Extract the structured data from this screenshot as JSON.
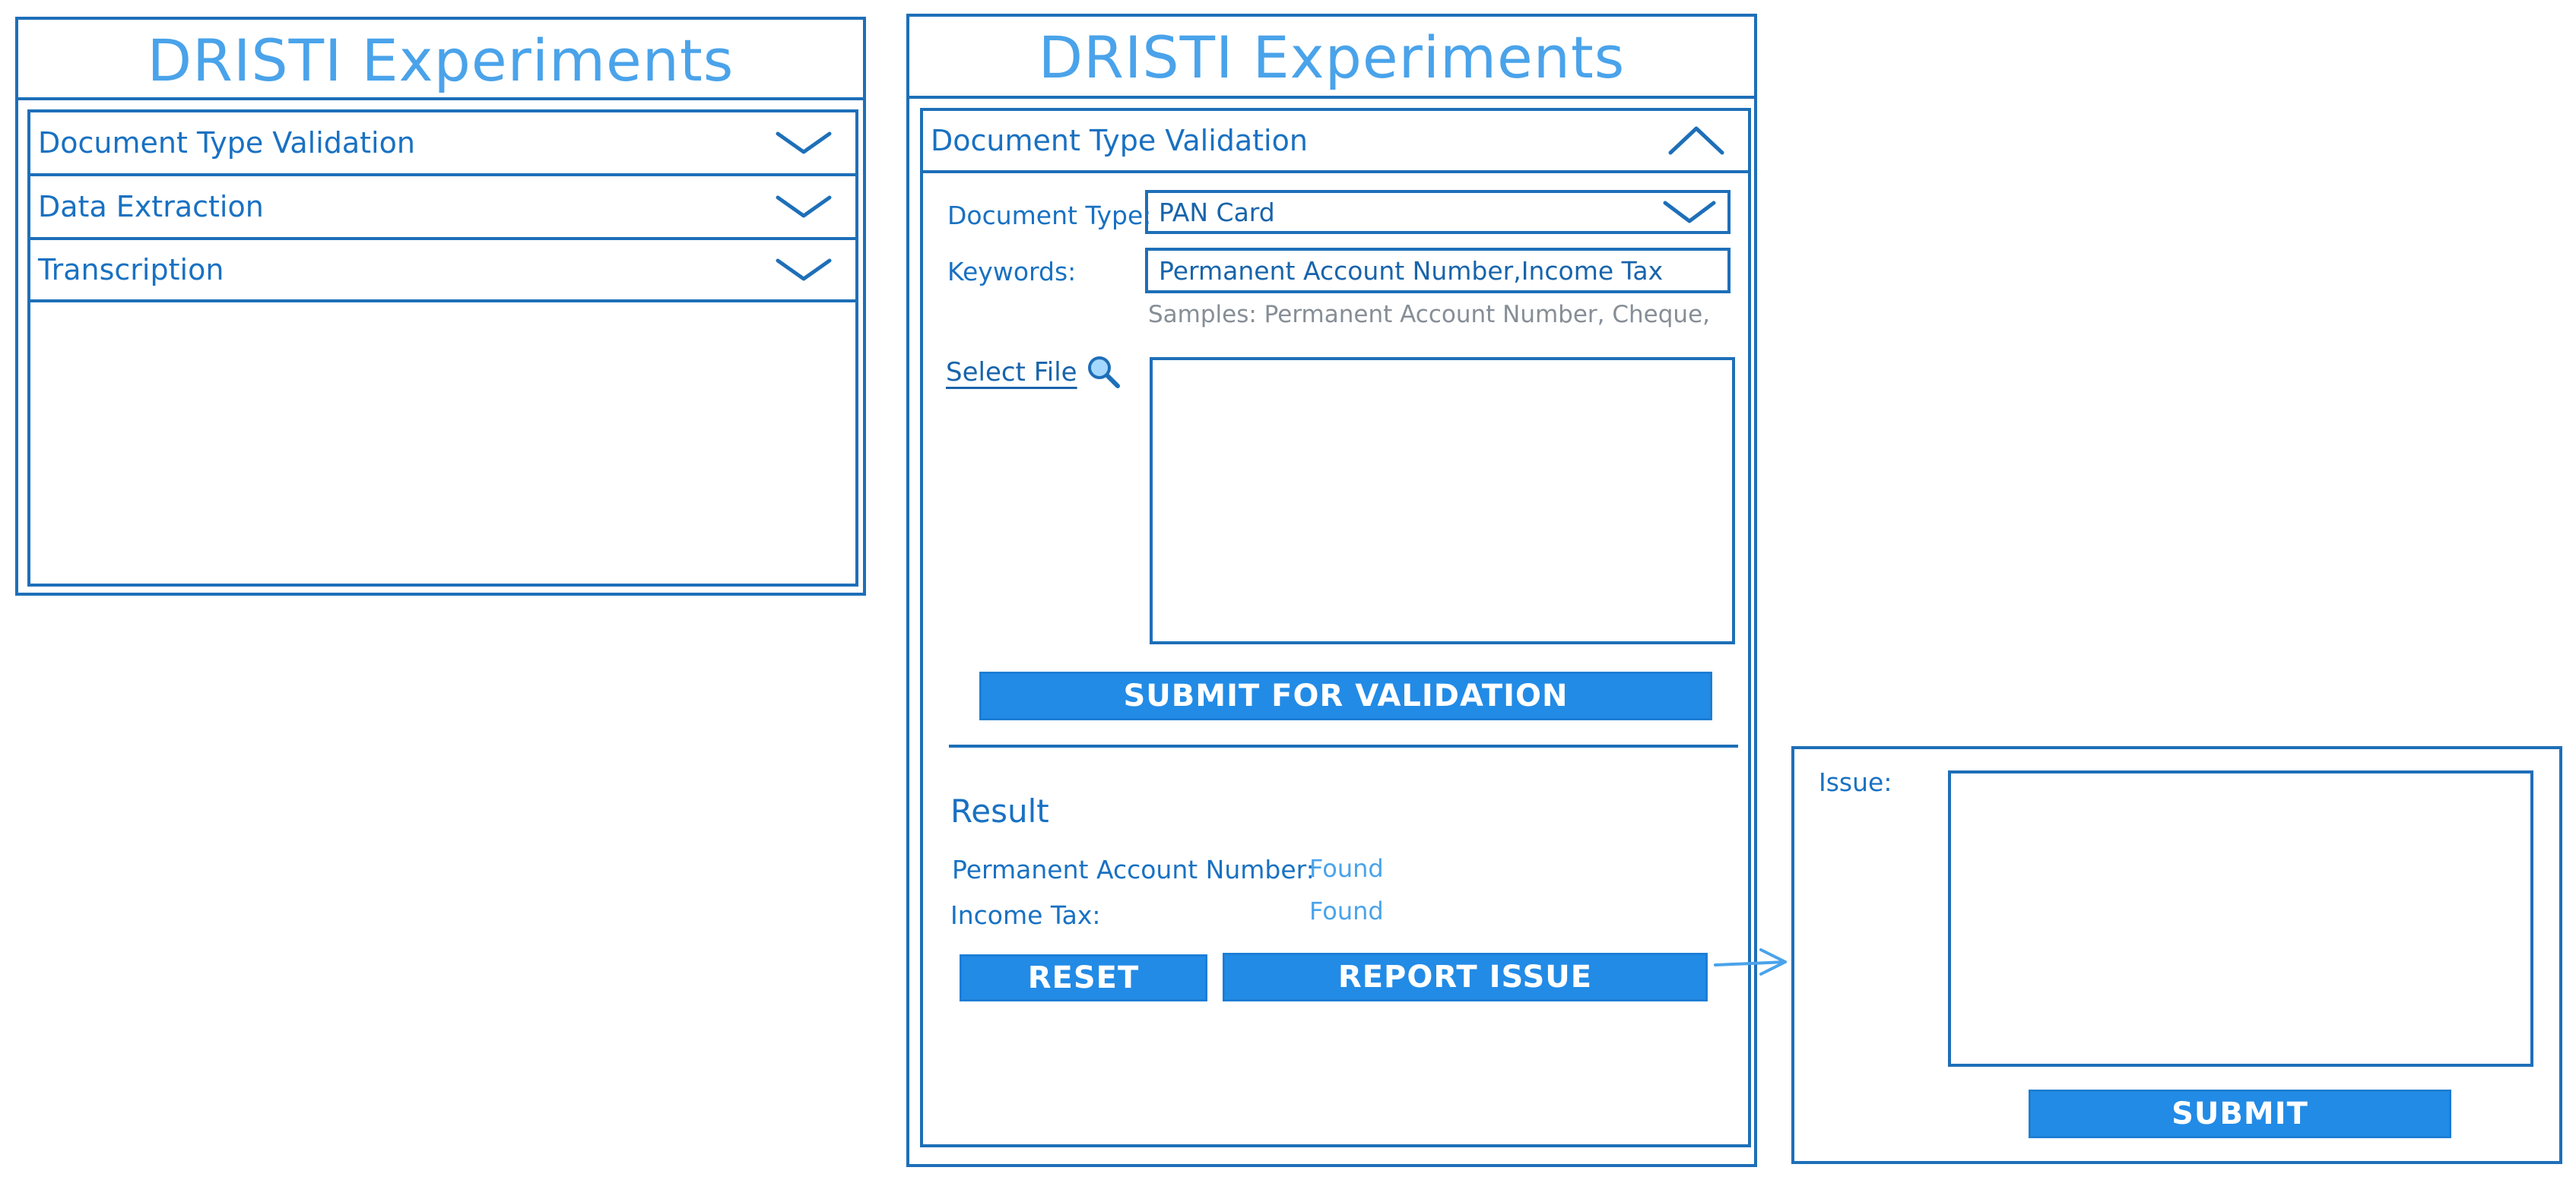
{
  "left_panel": {
    "title": "DRISTI Experiments",
    "accordion": [
      {
        "label": "Document Type Validation",
        "icon": "chevron-down-icon"
      },
      {
        "label": "Data Extraction",
        "icon": "chevron-down-icon"
      },
      {
        "label": "Transcription",
        "icon": "chevron-down-icon"
      }
    ]
  },
  "middle_panel": {
    "title": "DRISTI Experiments",
    "section": {
      "label": "Document Type Validation",
      "icon": "chevron-up-icon"
    },
    "document_type": {
      "label": "Document Type:",
      "value": "PAN Card"
    },
    "keywords": {
      "label": "Keywords:",
      "value": "Permanent Account Number,Income Tax",
      "hint": "Samples: Permanent Account Number, Cheque,"
    },
    "select_file": {
      "label": "Select File",
      "icon": "search-icon"
    },
    "submit_button": "SUBMIT FOR VALIDATION",
    "result": {
      "title": "Result",
      "rows": [
        {
          "label": "Permanent Account Number:",
          "value": "Found"
        },
        {
          "label": "Income Tax:",
          "value": "Found"
        }
      ]
    },
    "reset_button": "RESET",
    "report_button": "REPORT ISSUE"
  },
  "issue_panel": {
    "label": "Issue:",
    "submit_button": "SUBMIT"
  },
  "colors": {
    "stroke": "#1e6fb8",
    "title": "#4aa3ea",
    "button": "#228be6",
    "hint": "#868e96"
  }
}
